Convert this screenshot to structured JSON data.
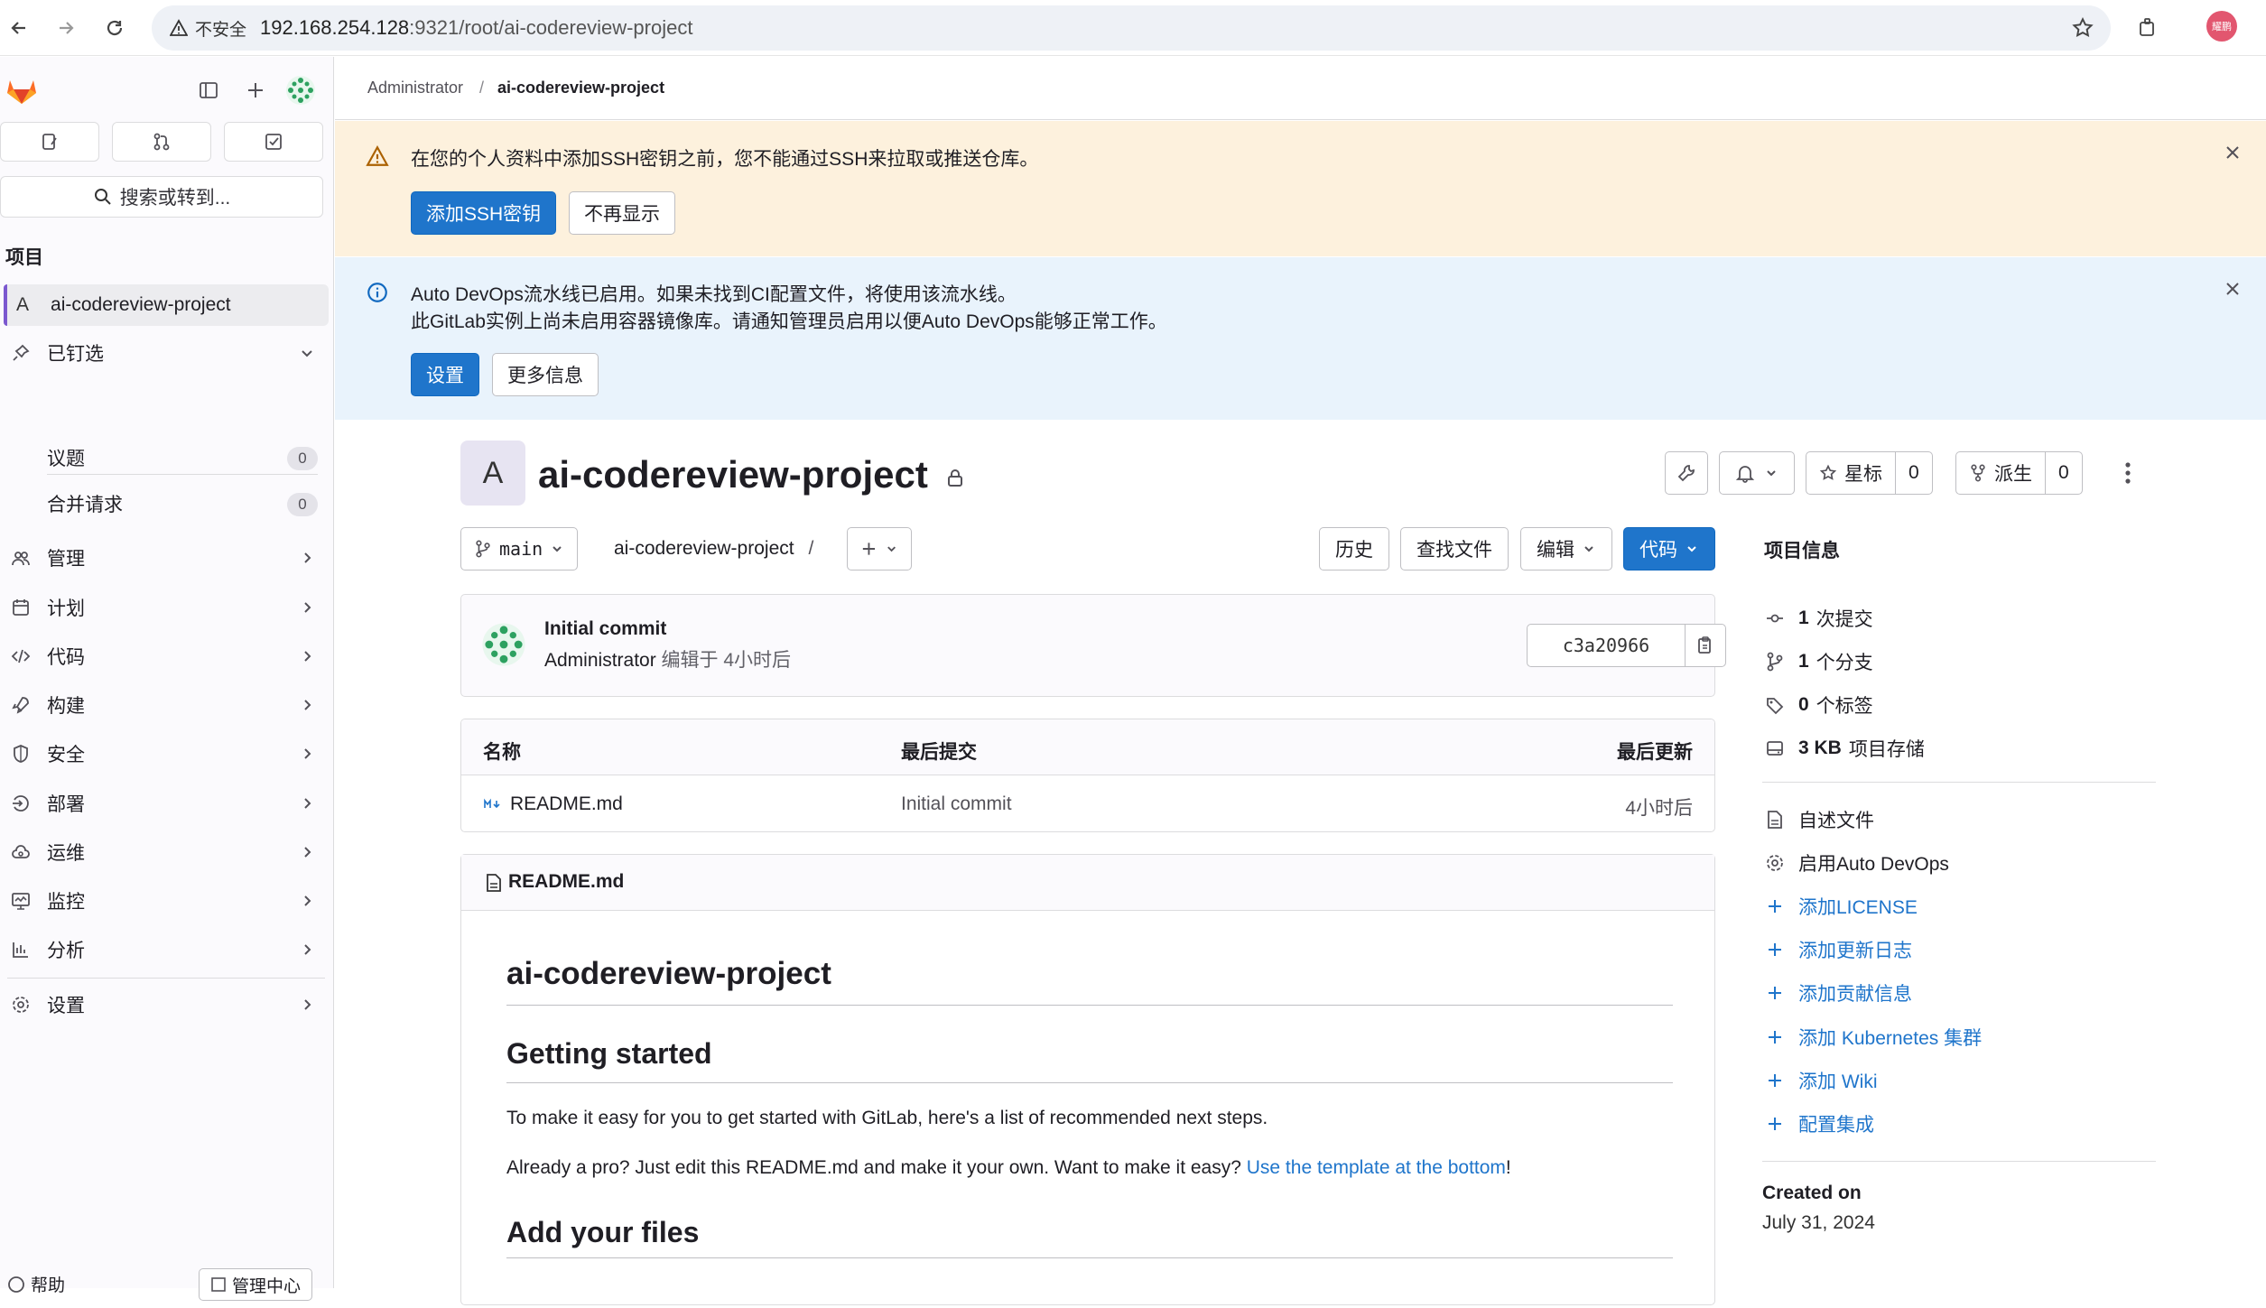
{
  "browser": {
    "insecure_label": "不安全",
    "url_host": "192.168.254.128",
    "url_rest": ":9321/root/ai-codereview-project",
    "profile_initials": "耀鹏"
  },
  "sidebar": {
    "search_label": "搜索或转到...",
    "section_heading": "项目",
    "current_project": {
      "letter": "A",
      "name": "ai-codereview-project"
    },
    "pinned": {
      "label": "已钉选",
      "items": [
        {
          "label": "议题",
          "count": "0"
        },
        {
          "label": "合并请求",
          "count": "0"
        }
      ]
    },
    "nav": [
      {
        "label": "管理",
        "icon": "users-icon"
      },
      {
        "label": "计划",
        "icon": "calendar-icon"
      },
      {
        "label": "代码",
        "icon": "code-icon"
      },
      {
        "label": "构建",
        "icon": "rocket-icon"
      },
      {
        "label": "安全",
        "icon": "shield-icon"
      },
      {
        "label": "部署",
        "icon": "deploy-icon"
      },
      {
        "label": "运维",
        "icon": "cloud-gear-icon"
      },
      {
        "label": "监控",
        "icon": "monitor-icon"
      },
      {
        "label": "分析",
        "icon": "chart-icon"
      },
      {
        "label": "设置",
        "icon": "settings-icon"
      }
    ],
    "footer": {
      "help": "帮助",
      "admin": "管理中心"
    }
  },
  "breadcrumb": {
    "parent": "Administrator",
    "current": "ai-codereview-project"
  },
  "alerts": {
    "ssh": {
      "text": "在您的个人资料中添加SSH密钥之前，您不能通过SSH来拉取或推送仓库。",
      "primary": "添加SSH密钥",
      "secondary": "不再显示"
    },
    "devops": {
      "line1": "Auto DevOps流水线已启用。如果未找到CI配置文件，将使用该流水线。",
      "line2": "此GitLab实例上尚未启用容器镜像库。请通知管理员启用以便Auto DevOps能够正常工作。",
      "primary": "设置",
      "secondary": "更多信息"
    }
  },
  "project": {
    "avatar_letter": "A",
    "title": "ai-codereview-project",
    "star_label": "星标",
    "star_count": "0",
    "fork_label": "派生",
    "fork_count": "0"
  },
  "toolbar": {
    "branch": "main",
    "path": "ai-codereview-project",
    "path_sep": "/",
    "history": "历史",
    "find_file": "查找文件",
    "edit": "编辑",
    "code": "代码"
  },
  "commit": {
    "title": "Initial commit",
    "author": "Administrator",
    "meta": "编辑于 4小时后",
    "sha": "c3a20966"
  },
  "files": {
    "headers": [
      "名称",
      "最后提交",
      "最后更新"
    ],
    "rows": [
      {
        "name": "README.md",
        "commit": "Initial commit",
        "updated": "4小时后"
      }
    ]
  },
  "readme": {
    "filename": "README.md",
    "h1": "ai-codereview-project",
    "h2_1": "Getting started",
    "p1": "To make it easy for you to get started with GitLab, here's a list of recommended next steps.",
    "p2_pre": "Already a pro? Just edit this README.md and make it your own. Want to make it easy? ",
    "p2_link": "Use the template at the bottom",
    "p2_post": "!",
    "h2_2": "Add your files"
  },
  "info": {
    "title": "项目信息",
    "stats": [
      {
        "value": "1",
        "label": "次提交"
      },
      {
        "value": "1",
        "label": "个分支"
      },
      {
        "value": "0",
        "label": "个标签"
      },
      {
        "value": "3 KB",
        "label": "项目存储"
      }
    ],
    "links": [
      {
        "label": "自述文件",
        "kind": "plain"
      },
      {
        "label": "启用Auto DevOps",
        "kind": "plain"
      },
      {
        "label": "添加LICENSE",
        "kind": "add"
      },
      {
        "label": "添加更新日志",
        "kind": "add"
      },
      {
        "label": "添加贡献信息",
        "kind": "add"
      },
      {
        "label": "添加 Kubernetes 集群",
        "kind": "add"
      },
      {
        "label": "添加 Wiki",
        "kind": "add"
      },
      {
        "label": "配置集成",
        "kind": "add"
      }
    ],
    "created_label": "Created on",
    "created_date": "July 31, 2024"
  },
  "colors": {
    "primary": "#1f75cb",
    "warning_bg": "#fdf1dd",
    "info_bg": "#e9f3fc",
    "sidebar_bg": "#fbfafd"
  }
}
